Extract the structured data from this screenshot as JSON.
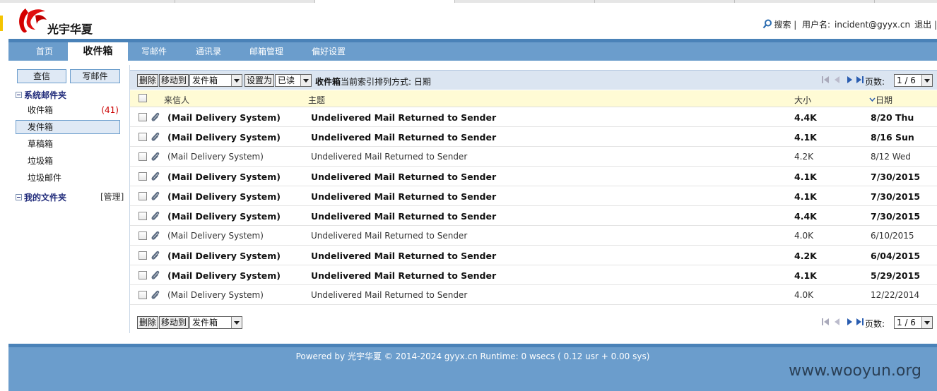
{
  "brand": {
    "logo_text": "光宇华夏",
    "logo_color": "#d40000"
  },
  "top_links": {
    "search": "搜索",
    "username_label": "用户名:",
    "username": "incident@gyyx.cn",
    "logout": "退出"
  },
  "nav": {
    "items": [
      {
        "label": "首页"
      },
      {
        "label": "收件箱",
        "active": true
      },
      {
        "label": "写邮件"
      },
      {
        "label": "通讯录"
      },
      {
        "label": "邮箱管理"
      },
      {
        "label": "偏好设置"
      }
    ]
  },
  "sidebar": {
    "check_mail": "查信",
    "compose": "写邮件",
    "system_folders_title": "系统邮件夹",
    "folders": [
      {
        "label": "收件箱",
        "count": "(41)"
      },
      {
        "label": "发件箱",
        "active": true
      },
      {
        "label": "草稿箱"
      },
      {
        "label": "垃圾箱"
      },
      {
        "label": "垃圾邮件"
      }
    ],
    "my_folders_title": "我的文件夹",
    "manage": "[管理]"
  },
  "toolbar": {
    "delete": "删除",
    "move_to": "移动到",
    "move_target": "发件箱",
    "set_as": "设置为",
    "set_target": "已读",
    "folder_name": "收件箱",
    "sort_text": "当前索引排列方式: 日期",
    "pages_label": "页数:",
    "page_value": "1 / 6"
  },
  "table": {
    "headers": {
      "from": "来信人",
      "subject": "主题",
      "size": "大小",
      "date": "日期"
    },
    "rows": [
      {
        "from": "(Mail Delivery System)",
        "subject": "Undelivered Mail Returned to Sender",
        "size": "4.4K",
        "date": "8/20 Thu",
        "unread": true
      },
      {
        "from": "(Mail Delivery System)",
        "subject": "Undelivered Mail Returned to Sender",
        "size": "4.1K",
        "date": "8/16 Sun",
        "unread": true
      },
      {
        "from": "(Mail Delivery System)",
        "subject": "Undelivered Mail Returned to Sender",
        "size": "4.2K",
        "date": "8/12 Wed",
        "unread": false
      },
      {
        "from": "(Mail Delivery System)",
        "subject": "Undelivered Mail Returned to Sender",
        "size": "4.1K",
        "date": "7/30/2015",
        "unread": true
      },
      {
        "from": "(Mail Delivery System)",
        "subject": "Undelivered Mail Returned to Sender",
        "size": "4.1K",
        "date": "7/30/2015",
        "unread": true
      },
      {
        "from": "(Mail Delivery System)",
        "subject": "Undelivered Mail Returned to Sender",
        "size": "4.4K",
        "date": "7/30/2015",
        "unread": true
      },
      {
        "from": "(Mail Delivery System)",
        "subject": "Undelivered Mail Returned to Sender",
        "size": "4.0K",
        "date": "6/10/2015",
        "unread": false
      },
      {
        "from": "(Mail Delivery System)",
        "subject": "Undelivered Mail Returned to Sender",
        "size": "4.2K",
        "date": "6/04/2015",
        "unread": true
      },
      {
        "from": "(Mail Delivery System)",
        "subject": "Undelivered Mail Returned to Sender",
        "size": "4.1K",
        "date": "5/29/2015",
        "unread": true
      },
      {
        "from": "(Mail Delivery System)",
        "subject": "Undelivered Mail Returned to Sender",
        "size": "4.0K",
        "date": "12/22/2014",
        "unread": false
      }
    ]
  },
  "footer": {
    "text": "Powered by 光宇华夏 © 2014-2024 gyyx.cn Runtime: 0 wsecs ( 0.12 usr + 0.00 sys)"
  },
  "watermark": "www.wooyun.org"
}
